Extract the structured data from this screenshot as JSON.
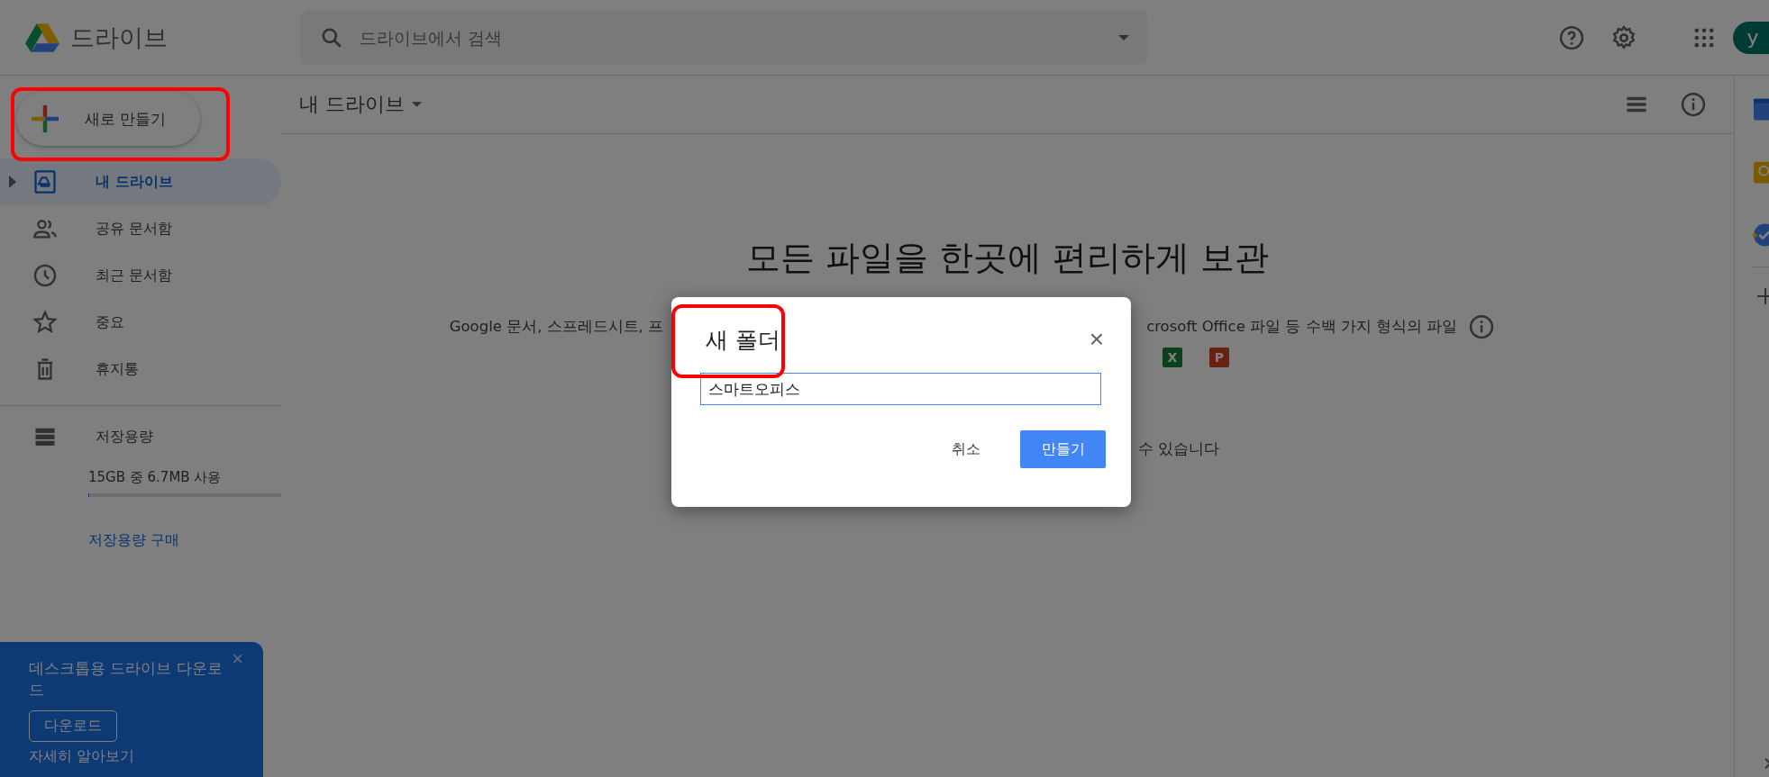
{
  "header": {
    "app_name": "드라이브",
    "search": {
      "placeholder": "드라이브에서 검색"
    },
    "avatar_letter": "y"
  },
  "sidebar": {
    "new_button": {
      "label": "새로 만들기",
      "highlighted": true
    },
    "items": [
      {
        "label": "내 드라이브",
        "kind": "drive",
        "selected": true,
        "has_toggle": true
      },
      {
        "label": "공유 문서함",
        "kind": "shared",
        "selected": false,
        "has_toggle": false
      },
      {
        "label": "최근 문서함",
        "kind": "recent",
        "selected": false,
        "has_toggle": false
      },
      {
        "label": "중요",
        "kind": "starred",
        "selected": false,
        "has_toggle": false
      },
      {
        "label": "휴지통",
        "kind": "trash",
        "selected": false,
        "has_toggle": false
      }
    ],
    "storage": {
      "label": "저장용량",
      "usage": "15GB 중 6.7MB 사용",
      "level": 0.0005,
      "buy_link": "저장용량 구매"
    }
  },
  "content": {
    "title": "내 드라이브",
    "heading": "모든 파일을 한곳에 편리하게 보관",
    "text_left": "Google 문서, 스프레드시트, 프",
    "text_right": "crosoft Office 파일 등 수백 가지 형식의 파일",
    "file_icons": [
      "X",
      "P"
    ],
    "note_right": "수 있습니다"
  },
  "dialog": {
    "title": "새 폴더",
    "title_highlighted": true,
    "close": "×",
    "value": "스마트오피스",
    "cancel": "취소",
    "create": "만들기"
  },
  "promo": {
    "text": "데스크톱용 드라이브 다운로드",
    "close": "×",
    "button": "다운로드",
    "link": "자세히 알아보기"
  }
}
